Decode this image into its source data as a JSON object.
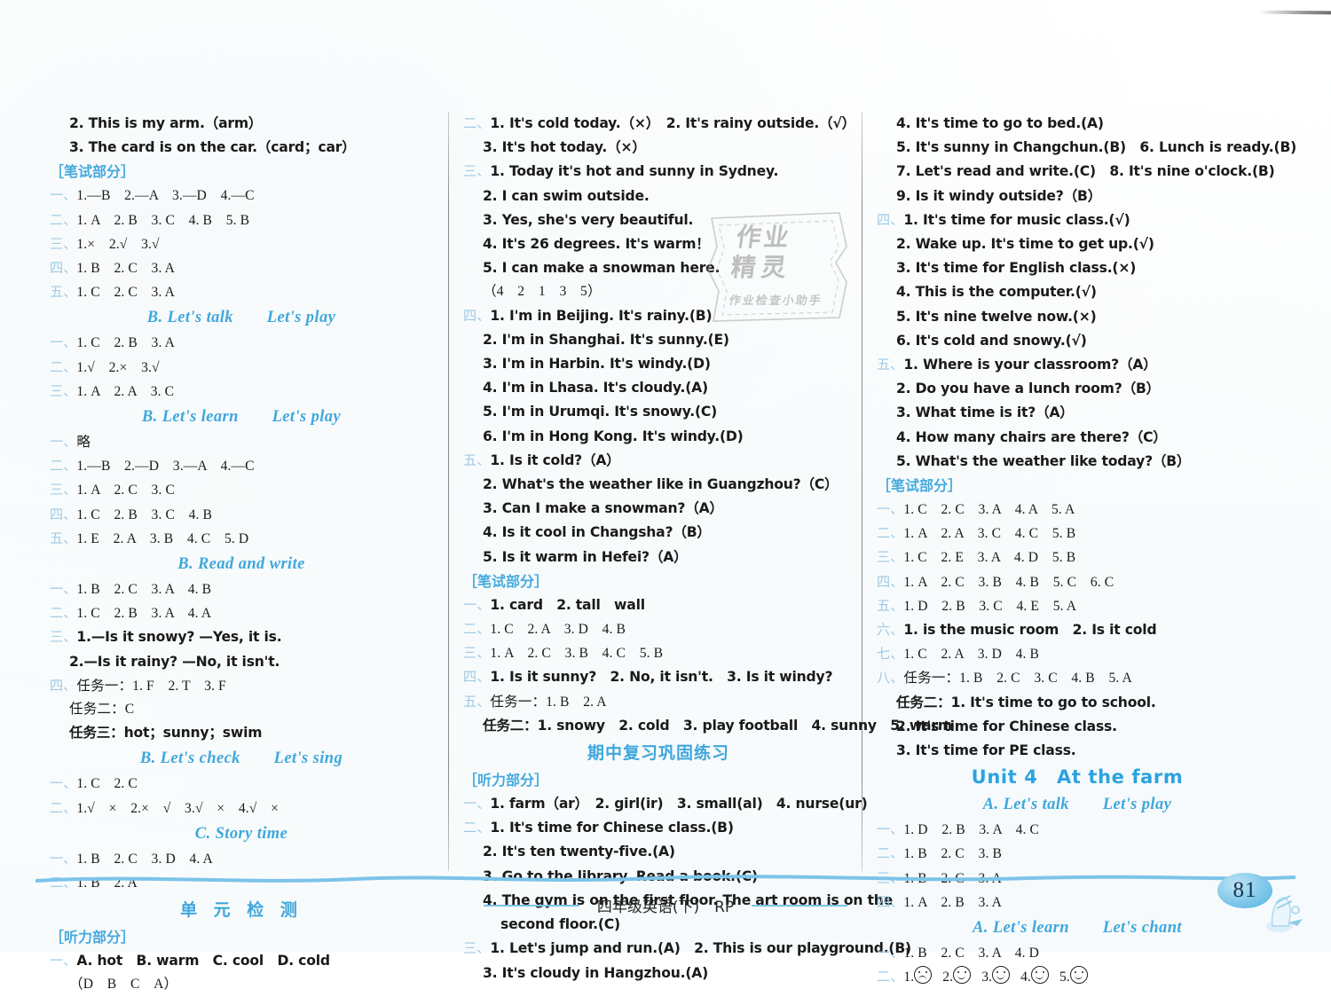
{
  "meta": {
    "page_number": "81",
    "footer_text": "四年级英语(下)　RP",
    "accent_blue": "#3fa7dc",
    "num_blue": "#9ecbe6"
  },
  "watermark": {
    "line1": "作业",
    "line2": "精灵",
    "line3": "作业检查小助手"
  },
  "col1": {
    "lines": [
      {
        "type": "ans",
        "indent": 1,
        "text": "2. This is my arm.（arm）",
        "style": "hand"
      },
      {
        "type": "ans",
        "indent": 1,
        "text": "3. The card is on the car.（card；car）",
        "style": "hand"
      },
      {
        "type": "bracket",
        "text": "［笔试部分］"
      },
      {
        "type": "num",
        "cn": "一、",
        "text": "1.—B　2.—A　3.—D　4.—C"
      },
      {
        "type": "num",
        "cn": "二、",
        "text": "1. A　2. B　3. C　4. B　5. B"
      },
      {
        "type": "num",
        "cn": "三、",
        "text": "1.×　2.√　3.√"
      },
      {
        "type": "num",
        "cn": "四、",
        "text": "1. B　2. C　3. A"
      },
      {
        "type": "num",
        "cn": "五、",
        "text": "1. C　2. C　3. A"
      },
      {
        "type": "subhead",
        "text": "B. Let's talk　　Let's play"
      },
      {
        "type": "num",
        "cn": "一、",
        "text": "1. C　2. B　3. A"
      },
      {
        "type": "num",
        "cn": "二、",
        "text": "1.√　2.×　3.√"
      },
      {
        "type": "num",
        "cn": "三、",
        "text": "1. A　2. A　3. C"
      },
      {
        "type": "subhead",
        "text": "B. Let's learn　　Let's play"
      },
      {
        "type": "num",
        "cn": "一、",
        "text": "略"
      },
      {
        "type": "num",
        "cn": "二、",
        "text": "1.—B　2.—D　3.—A　4.—C"
      },
      {
        "type": "num",
        "cn": "三、",
        "text": "1. A　2. C　3. C"
      },
      {
        "type": "num",
        "cn": "四、",
        "text": "1. C　2. B　3. C　4. B"
      },
      {
        "type": "num",
        "cn": "五、",
        "text": "1. E　2. A　3. B　4. C　5. D"
      },
      {
        "type": "subhead",
        "text": "B. Read and write"
      },
      {
        "type": "num",
        "cn": "一、",
        "text": "1. B　2. C　3. A　4. B"
      },
      {
        "type": "num",
        "cn": "二、",
        "text": "1. C　2. B　3. A　4. A"
      },
      {
        "type": "num",
        "cn": "三、",
        "text": "1.—Is it snowy? —Yes, it is.",
        "style": "hand"
      },
      {
        "type": "ans",
        "indent": 1,
        "text": "2.—Is it rainy? —No, it isn't.",
        "style": "hand"
      },
      {
        "type": "num",
        "cn": "四、",
        "text": "任务一：1. F　2. T　3. F"
      },
      {
        "type": "ans",
        "indent": 1,
        "text": "任务二：C"
      },
      {
        "type": "ans",
        "indent": 1,
        "text": "任务三：hot；sunny；swim",
        "style": "hand"
      },
      {
        "type": "subhead",
        "text": "B. Let's check　　Let's sing"
      },
      {
        "type": "num",
        "cn": "一、",
        "text": "1. C　2. C"
      },
      {
        "type": "num",
        "cn": "二、",
        "text": "1.√　×　2.×　√　3.√　×　4.√　×"
      },
      {
        "type": "subhead",
        "text": "C. Story time"
      },
      {
        "type": "num",
        "cn": "一、",
        "text": "1. B　2. C　3. D　4. A"
      },
      {
        "type": "num",
        "cn": "二、",
        "text": "1. B　2. A"
      },
      {
        "type": "cnhead",
        "text": "单 元 检 测"
      },
      {
        "type": "bracket",
        "text": "［听力部分］"
      },
      {
        "type": "num",
        "cn": "一、",
        "text": "A. hot　B. warm　C. cool　D. cold",
        "style": "hand"
      },
      {
        "type": "ans",
        "indent": 1,
        "text": "（D　B　C　A）"
      }
    ]
  },
  "col2": {
    "lines": [
      {
        "type": "num",
        "cn": "二、",
        "text": "1. It's cold today.（×）　2. It's rainy outside.（√）",
        "style": "hand"
      },
      {
        "type": "ans",
        "indent": 1,
        "text": "3. It's hot today.（×）",
        "style": "hand"
      },
      {
        "type": "num",
        "cn": "三、",
        "text": "1. Today it's hot and sunny in Sydney.",
        "style": "hand"
      },
      {
        "type": "ans",
        "indent": 1,
        "text": "2. I can swim outside.",
        "style": "hand"
      },
      {
        "type": "ans",
        "indent": 1,
        "text": "3. Yes, she's very beautiful.",
        "style": "hand"
      },
      {
        "type": "ans",
        "indent": 1,
        "text": "4. It's 26 degrees. It's warm！",
        "style": "hand"
      },
      {
        "type": "ans",
        "indent": 1,
        "text": "5. I can make a snowman here.",
        "style": "hand"
      },
      {
        "type": "ans",
        "indent": 1,
        "text": "（4　2　1　3　5）"
      },
      {
        "type": "num",
        "cn": "四、",
        "text": "1. I'm in Beijing. It's rainy.(B)",
        "style": "hand"
      },
      {
        "type": "ans",
        "indent": 1,
        "text": "2. I'm in Shanghai. It's sunny.(E)",
        "style": "hand"
      },
      {
        "type": "ans",
        "indent": 1,
        "text": "3. I'm in Harbin. It's windy.(D)",
        "style": "hand"
      },
      {
        "type": "ans",
        "indent": 1,
        "text": "4. I'm in Lhasa. It's cloudy.(A)",
        "style": "hand"
      },
      {
        "type": "ans",
        "indent": 1,
        "text": "5. I'm in Urumqi. It's snowy.(C)",
        "style": "hand"
      },
      {
        "type": "ans",
        "indent": 1,
        "text": "6. I'm in Hong Kong. It's windy.(D)",
        "style": "hand"
      },
      {
        "type": "num",
        "cn": "五、",
        "text": "1. Is it cold?（A）",
        "style": "hand"
      },
      {
        "type": "ans",
        "indent": 1,
        "text": "2. What's the weather like in Guangzhou?（C）",
        "style": "hand"
      },
      {
        "type": "ans",
        "indent": 1,
        "text": "3. Can I make a snowman?（A）",
        "style": "hand"
      },
      {
        "type": "ans",
        "indent": 1,
        "text": "4. Is it cool in Changsha?（B）",
        "style": "hand"
      },
      {
        "type": "ans",
        "indent": 1,
        "text": "5. Is it warm in Hefei?（A）",
        "style": "hand"
      },
      {
        "type": "bracket",
        "text": "［笔试部分］"
      },
      {
        "type": "num",
        "cn": "一、",
        "text": "1. card　2. tall　wall",
        "style": "hand"
      },
      {
        "type": "num",
        "cn": "二、",
        "text": "1. C　2. A　3. D　4. B"
      },
      {
        "type": "num",
        "cn": "三、",
        "text": "1. A　2. C　3. B　4. C　5. B"
      },
      {
        "type": "num",
        "cn": "四、",
        "text": "1. Is it sunny?　2. No, it isn't.　3. Is it windy?",
        "style": "hand"
      },
      {
        "type": "num",
        "cn": "五、",
        "text": "任务一：1. B　2. A"
      },
      {
        "type": "ans",
        "indent": 1,
        "text": "任务二：1. snowy　2. cold　3. play football　4. sunny　5. warm",
        "style": "hand"
      },
      {
        "type": "cnhead-tight",
        "text": "期中复习巩固练习"
      },
      {
        "type": "bracket",
        "text": "［听力部分］"
      },
      {
        "type": "num",
        "cn": "一、",
        "text": "1. farm（ar）　2. girl(ir)　3. small(al)　4. nurse(ur)",
        "style": "hand"
      },
      {
        "type": "num",
        "cn": "二、",
        "text": "1. It's time for Chinese class.(B)",
        "style": "hand"
      },
      {
        "type": "ans",
        "indent": 1,
        "text": "2. It's ten twenty-five.(A)",
        "style": "hand"
      },
      {
        "type": "ans",
        "indent": 1,
        "text": "3. Go to the library. Read a book.(C)",
        "style": "hand"
      },
      {
        "type": "ans",
        "indent": 1,
        "text": "4. The gym is on the first floor. The art room is on the",
        "style": "hand"
      },
      {
        "type": "ans",
        "indent": 2,
        "text": "second floor.(C)",
        "style": "hand"
      },
      {
        "type": "num",
        "cn": "三、",
        "text": "1. Let's jump and run.(A)　2. This is our playground.(B)",
        "style": "hand"
      },
      {
        "type": "ans",
        "indent": 1,
        "text": "3. It's cloudy in Hangzhou.(A)",
        "style": "hand"
      }
    ]
  },
  "col3": {
    "lines": [
      {
        "type": "ans",
        "indent": 1,
        "text": "4. It's time to go to bed.(A)",
        "style": "hand"
      },
      {
        "type": "ans",
        "indent": 1,
        "text": "5. It's sunny in Changchun.(B)　6. Lunch is ready.(B)",
        "style": "hand"
      },
      {
        "type": "ans",
        "indent": 1,
        "text": "7. Let's read and write.(C)　8. It's nine o'clock.(B)",
        "style": "hand"
      },
      {
        "type": "ans",
        "indent": 1,
        "text": "9. Is it windy outside?（B）",
        "style": "hand"
      },
      {
        "type": "num",
        "cn": "四、",
        "text": "1. It's time for music class.(√)",
        "style": "hand"
      },
      {
        "type": "ans",
        "indent": 1,
        "text": "2. Wake up. It's time to get up.(√)",
        "style": "hand"
      },
      {
        "type": "ans",
        "indent": 1,
        "text": "3. It's time for English class.(×)",
        "style": "hand"
      },
      {
        "type": "ans",
        "indent": 1,
        "text": "4. This is the computer.(√)",
        "style": "hand"
      },
      {
        "type": "ans",
        "indent": 1,
        "text": "5. It's nine twelve now.(×)",
        "style": "hand"
      },
      {
        "type": "ans",
        "indent": 1,
        "text": "6. It's cold and snowy.(√)",
        "style": "hand"
      },
      {
        "type": "num",
        "cn": "五、",
        "text": "1. Where is your classroom?（A）",
        "style": "hand"
      },
      {
        "type": "ans",
        "indent": 1,
        "text": "2. Do you have a lunch room?（B）",
        "style": "hand"
      },
      {
        "type": "ans",
        "indent": 1,
        "text": "3. What time is it?（A）",
        "style": "hand"
      },
      {
        "type": "ans",
        "indent": 1,
        "text": "4. How many chairs are there?（C）",
        "style": "hand"
      },
      {
        "type": "ans",
        "indent": 1,
        "text": "5. What's the weather like today?（B）",
        "style": "hand"
      },
      {
        "type": "bracket",
        "text": "［笔试部分］"
      },
      {
        "type": "num",
        "cn": "一、",
        "text": "1. C　2. C　3. A　4. A　5. A"
      },
      {
        "type": "num",
        "cn": "二、",
        "text": "1. A　2. A　3. C　4. C　5. B"
      },
      {
        "type": "num",
        "cn": "三、",
        "text": "1. C　2. E　3. A　4. D　5. B"
      },
      {
        "type": "num",
        "cn": "四、",
        "text": "1. A　2. C　3. B　4. B　5. C　6. C"
      },
      {
        "type": "num",
        "cn": "五、",
        "text": "1. D　2. B　3. C　4. E　5. A"
      },
      {
        "type": "num",
        "cn": "六、",
        "text": "1. is the music room　2. Is it cold",
        "style": "hand"
      },
      {
        "type": "num",
        "cn": "七、",
        "text": "1. C　2. A　3. D　4. B"
      },
      {
        "type": "num",
        "cn": "八、",
        "text": "任务一：1. B　2. C　3. C　4. B　5. A"
      },
      {
        "type": "ans",
        "indent": 1,
        "text": "任务二：1. It's time to go to school.",
        "style": "hand"
      },
      {
        "type": "ans",
        "indent": 1,
        "text": "2. It's time for Chinese class.",
        "style": "hand"
      },
      {
        "type": "ans",
        "indent": 1,
        "text": "3. It's time for PE class.",
        "style": "hand"
      },
      {
        "type": "unithead",
        "text": "Unit 4　At the farm"
      },
      {
        "type": "subhead",
        "text": "A. Let's talk　　Let's play"
      },
      {
        "type": "num",
        "cn": "一、",
        "text": "1. D　2. B　3. A　4. C"
      },
      {
        "type": "num",
        "cn": "二、",
        "text": "1. B　2. C　3. B"
      },
      {
        "type": "num",
        "cn": "三、",
        "text": "1. B　2. C　3. A"
      },
      {
        "type": "num",
        "cn": "四、",
        "text": "1. A　2. B　3. A"
      },
      {
        "type": "subhead",
        "text": "A. Let's learn　　Let's chant"
      },
      {
        "type": "num",
        "cn": "一、",
        "text": "1. B　2. C　3. A　4. D"
      },
      {
        "type": "emoji-row",
        "cn": "二、",
        "items": [
          "sad",
          "happy",
          "happy",
          "happy",
          "happy"
        ]
      }
    ]
  }
}
